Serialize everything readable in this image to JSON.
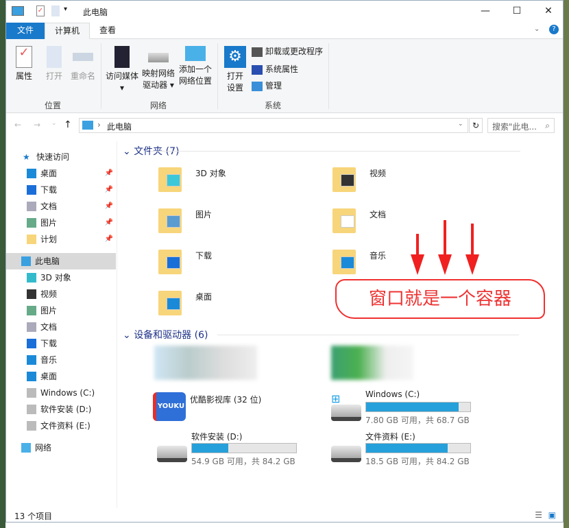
{
  "window": {
    "title": "此电脑",
    "minimize": "—",
    "maximize": "☐",
    "close": "✕"
  },
  "tabs": [
    {
      "label": "文件"
    },
    {
      "label": "计算机"
    },
    {
      "label": "查看"
    }
  ],
  "ribbon": {
    "location": {
      "label": "位置",
      "buttons": [
        "属性",
        "打开",
        "重命名"
      ]
    },
    "network": {
      "label": "网络",
      "media": "访问媒体",
      "map_drive_1": "映射网络",
      "map_drive_2": "驱动器",
      "add_loc_1": "添加一个",
      "add_loc_2": "网络位置"
    },
    "system": {
      "label": "系统",
      "open_1": "打开",
      "open_2": "设置",
      "items": [
        "卸载或更改程序",
        "系统属性",
        "管理"
      ]
    }
  },
  "address": {
    "path": "此电脑",
    "search_placeholder": "搜索\"此电..."
  },
  "nav": {
    "quick_access": "快速访问",
    "quick": [
      {
        "label": "桌面"
      },
      {
        "label": "下载"
      },
      {
        "label": "文档"
      },
      {
        "label": "图片"
      },
      {
        "label": "计划"
      }
    ],
    "this_pc": "此电脑",
    "pc": [
      {
        "label": "3D 对象"
      },
      {
        "label": "视频"
      },
      {
        "label": "图片"
      },
      {
        "label": "文档"
      },
      {
        "label": "下载"
      },
      {
        "label": "音乐"
      },
      {
        "label": "桌面"
      },
      {
        "label": "Windows (C:)"
      },
      {
        "label": "软件安装 (D:)"
      },
      {
        "label": "文件资料 (E:)"
      }
    ],
    "network": "网络"
  },
  "folders": {
    "header": "文件夹 (7)",
    "items": [
      "3D 对象",
      "视频",
      "图片",
      "文档",
      "下载",
      "音乐",
      "桌面"
    ]
  },
  "devices": {
    "header": "设备和驱动器 (6)",
    "youku": "优酷影视库 (32 位)",
    "drives": [
      {
        "name": "Windows (C:)",
        "info": "7.80 GB 可用，共 68.7 GB",
        "used_fraction": 0.886
      },
      {
        "name": "软件安装 (D:)",
        "info": "54.9 GB 可用，共 84.2 GB",
        "used_fraction": 0.348
      },
      {
        "name": "文件资料 (E:)",
        "info": "18.5 GB 可用，共 84.2 GB",
        "used_fraction": 0.78
      }
    ]
  },
  "status": {
    "count": "13 个项目"
  },
  "annotation": {
    "text": "窗口就是一个容器",
    "color": "#f02020"
  },
  "colors": {
    "accent": "#1979ca",
    "bar": "#26a0da"
  }
}
